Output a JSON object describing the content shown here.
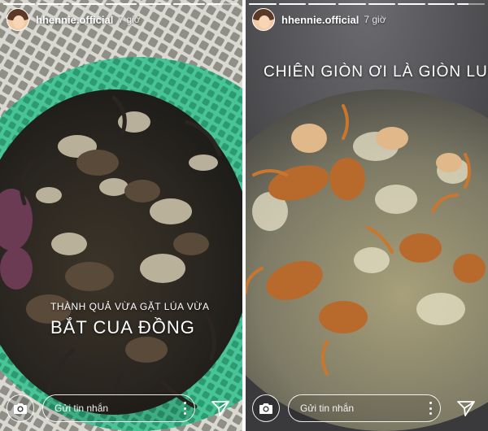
{
  "stories": [
    {
      "username": "hhennie.official",
      "time": "7 giờ",
      "caption_small": "THÀNH QUẢ VỪA GẶT LÚA VỪA",
      "caption_large": "BẮT CUA ĐỒNG",
      "reply_placeholder": "Gửi tin nhắn"
    },
    {
      "username": "hhennie.official",
      "time": "7 giờ",
      "caption_large": "CHIÊN GIÒN ƠI LÀ GIÒN LUÔN",
      "reply_placeholder": "Gửi tin nhắn"
    }
  ],
  "icons": {
    "camera": "camera-icon",
    "more": "more-options-icon",
    "send": "send-direct-icon"
  },
  "colors": {
    "basket_green": "#3fb58a",
    "oil_gray": "#8a8a80",
    "fried_orange": "#d98a38"
  }
}
